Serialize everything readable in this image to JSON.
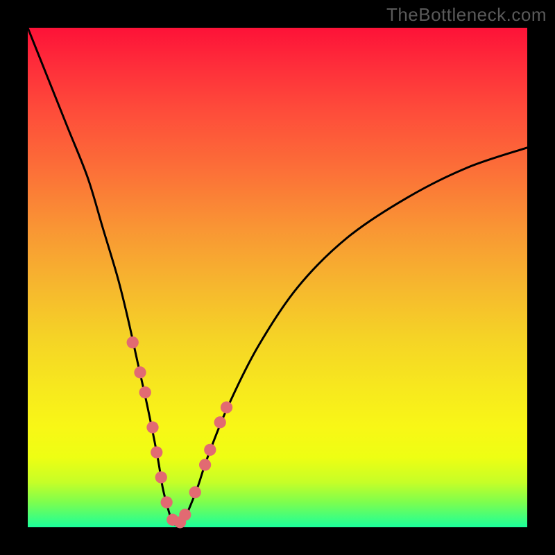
{
  "watermark": "TheBottleneck.com",
  "chart_data": {
    "type": "line",
    "title": "",
    "xlabel": "",
    "ylabel": "",
    "xlim": [
      0,
      100
    ],
    "ylim": [
      0,
      100
    ],
    "grid": false,
    "series": [
      {
        "name": "bottleneck-curve",
        "x": [
          0,
          4,
          8,
          12,
          15,
          18,
          20,
          22,
          24,
          26,
          27,
          28,
          29,
          30,
          31,
          32,
          34,
          36,
          40,
          46,
          54,
          64,
          76,
          88,
          100
        ],
        "values": [
          100,
          90,
          80,
          70,
          60,
          50,
          42,
          33,
          24,
          14,
          8,
          4,
          1,
          0.5,
          1,
          3,
          8,
          14,
          24,
          36,
          48,
          58,
          66,
          72,
          76
        ]
      }
    ],
    "markers": {
      "name": "highlighted-points",
      "color": "#e26a72",
      "radius_pct": 1.2,
      "points": [
        {
          "x": 21.0,
          "y": 37.0
        },
        {
          "x": 22.5,
          "y": 31.0
        },
        {
          "x": 23.5,
          "y": 27.0
        },
        {
          "x": 25.0,
          "y": 20.0
        },
        {
          "x": 25.8,
          "y": 15.0
        },
        {
          "x": 26.7,
          "y": 10.0
        },
        {
          "x": 27.8,
          "y": 5.0
        },
        {
          "x": 29.0,
          "y": 1.5
        },
        {
          "x": 30.5,
          "y": 1.0
        },
        {
          "x": 31.5,
          "y": 2.5
        },
        {
          "x": 33.5,
          "y": 7.0
        },
        {
          "x": 35.5,
          "y": 12.5
        },
        {
          "x": 36.5,
          "y": 15.5
        },
        {
          "x": 38.5,
          "y": 21.0
        },
        {
          "x": 39.8,
          "y": 24.0
        }
      ]
    },
    "colors": {
      "curve_stroke": "#000000",
      "marker_fill": "#e26a72",
      "frame_bg": "#000000"
    }
  }
}
